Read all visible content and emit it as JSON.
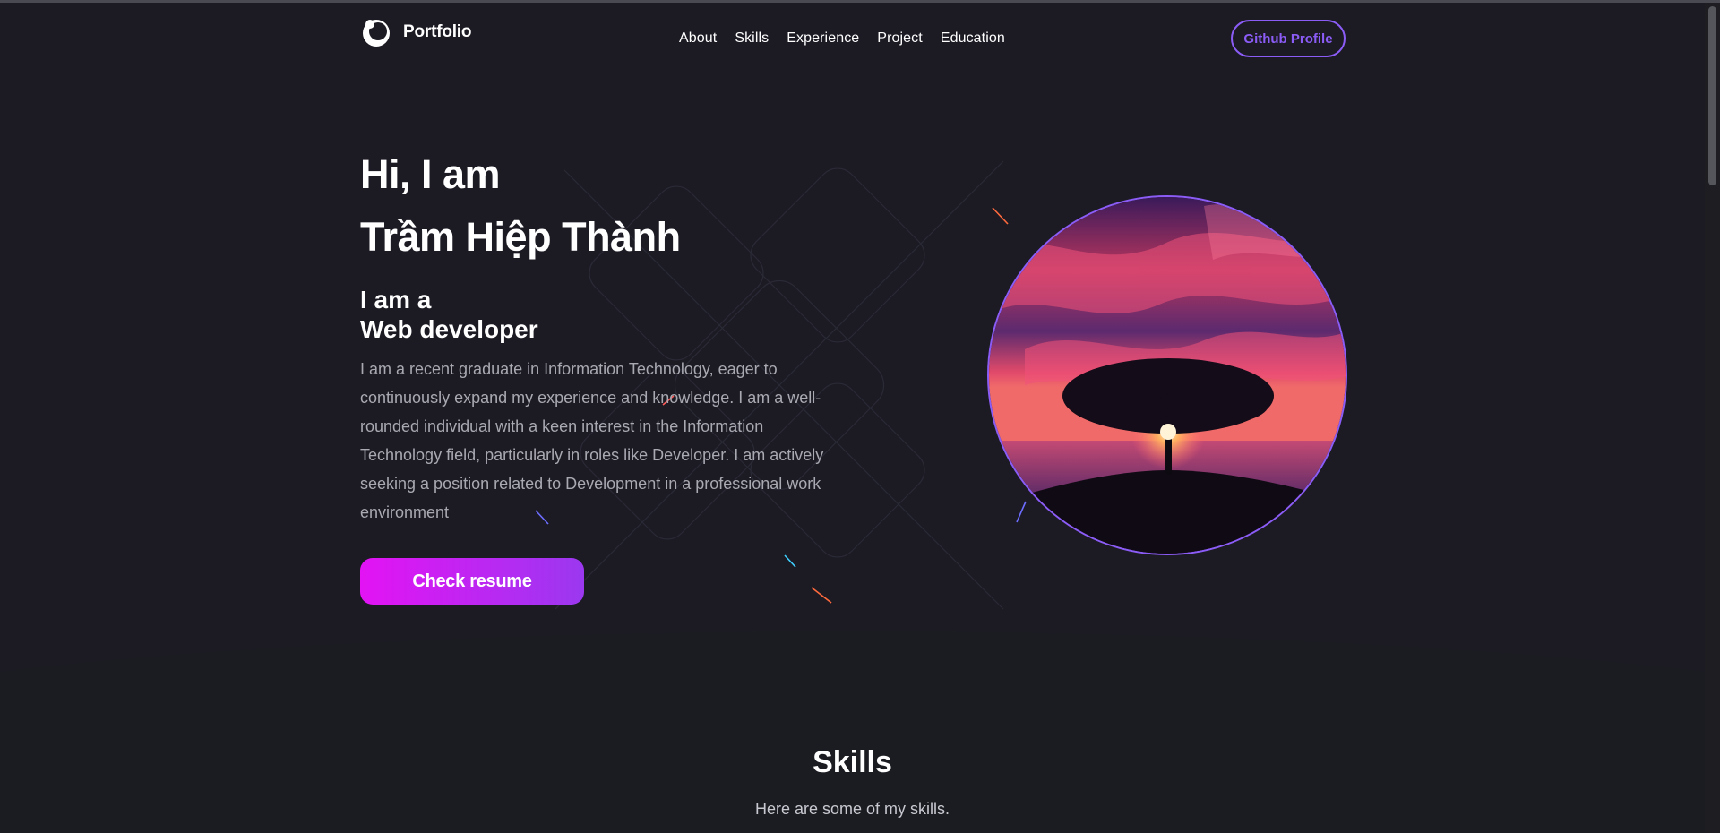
{
  "nav": {
    "brand": "Portfolio",
    "links": [
      "About",
      "Skills",
      "Experience",
      "Project",
      "Education"
    ],
    "github_label": "Github Profile"
  },
  "hero": {
    "greeting_line1": "Hi, I am",
    "name": "Trầm Hiệp Thành",
    "role_line1": "I am a",
    "role_line2": "Web developer",
    "bio": "I am a recent graduate in Information Technology, eager to continuously expand my experience and knowledge. I am a well-rounded individual with a keen interest in the Information Technology field, particularly in roles like Developer. I am actively seeking a position related to Development in a professional work environment",
    "cta_label": "Check resume"
  },
  "skills": {
    "title": "Skills",
    "subtitle": "Here are some of my skills."
  },
  "colors": {
    "background": "#1c1b24",
    "accent": "#8b5cf6",
    "cta_start": "#e313f4",
    "cta_end": "#9b38f0"
  }
}
